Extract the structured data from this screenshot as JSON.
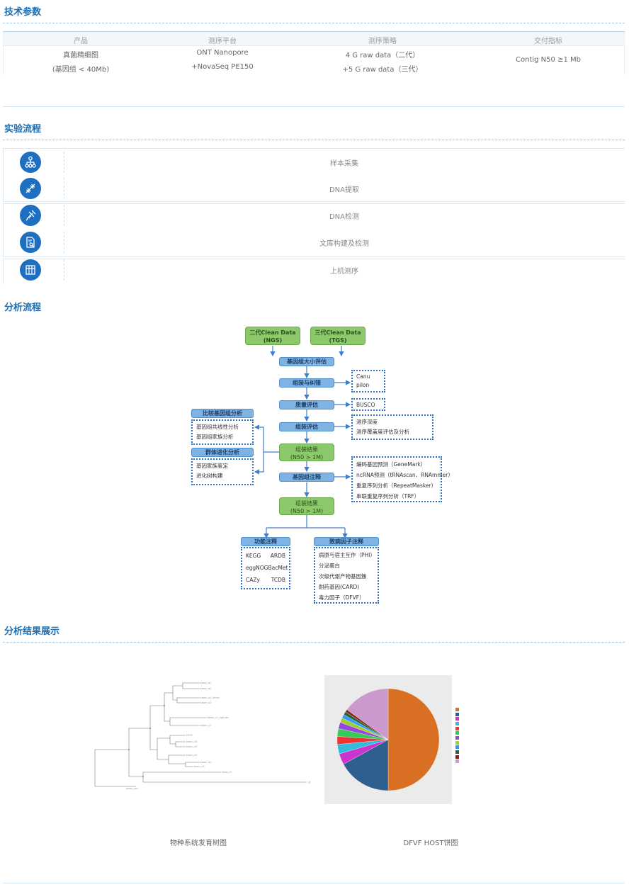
{
  "sections": {
    "tech": "技术参数",
    "experiment": "实验流程",
    "analysis": "分析流程",
    "results": "分析结果展示"
  },
  "spec_table": {
    "headers": [
      "产品",
      "测序平台",
      "测序策略",
      "交付指标"
    ],
    "product_line1": "真菌精细图",
    "product_line2": "(基因组 < 40Mb)",
    "platform_line1": "ONT Nanopore",
    "platform_line2": "+NovaSeq PE150",
    "strategy_line1": "4 G raw data（二代）",
    "strategy_line2": "+5 G raw data（三代）",
    "delivery": "Contig N50 ≥1 Mb"
  },
  "experiment_steps": [
    {
      "label": "样本采集",
      "icon": "sample-network-icon"
    },
    {
      "label": "DNA提取",
      "icon": "dna-icon"
    },
    {
      "label": "DNA检测",
      "icon": "dna-test-icon"
    },
    {
      "label": "文库构建及检测",
      "icon": "document-search-icon"
    },
    {
      "label": "上机测序",
      "icon": "grid-sequencer-icon"
    }
  ],
  "analysis_flow": {
    "ngs": "二代Clean Data\n(NGS)",
    "tgs": "三代Clean Data\n(TGS)",
    "step1": "基因组大小评估",
    "step2": "组装与纠错",
    "step2_notes": [
      "Canu",
      "pilon"
    ],
    "step3": "质量评估",
    "step3_notes": [
      "BUSCO"
    ],
    "step4": "组装评估",
    "step4_notes": [
      "测序深度",
      "测序覆盖度评估及分析"
    ],
    "result1": "组装结果\n(N50 > 1M)",
    "step5": "基因组注释",
    "step5_notes": [
      "编码基因预测（GeneMark）",
      "ncRNA预测（tRNAscan、RNAmmer）",
      "重复序列分析（RepeatMasker）",
      "串联重复序列分析（TRF）"
    ],
    "result2": "组装结果\n(N50 > 1M)",
    "left_top_title": "比较基因组分析",
    "left_top": [
      "基因组共线性分析",
      "基因组家族分析"
    ],
    "left_mid_title": "群体进化分析",
    "left_mid": [
      "基因家族鉴定",
      "进化树构建"
    ],
    "bottom_left_title": "功能注释",
    "bottom_left": [
      [
        "KEGG",
        "ARDB"
      ],
      [
        "eggNOG",
        "BacMet"
      ],
      [
        "CAZy",
        "TCDB"
      ]
    ],
    "bottom_right_title": "致病因子注释",
    "bottom_right": [
      "病原与宿主互作（PHI）",
      "分泌蛋白",
      "次级代谢产物基因簇",
      "耐药基因(CARD)",
      "毒力因子（DFVF）"
    ]
  },
  "results": {
    "caption_left": "物种系统发育树图",
    "caption_right": "DFVF HOST饼图"
  },
  "chart_data": {
    "type": "pie",
    "title": "",
    "slices": [
      {
        "label": "",
        "value": 50,
        "color": "#d86f23"
      },
      {
        "label": "",
        "value": 17,
        "color": "#2f5f8f"
      },
      {
        "label": "",
        "value": 3.5,
        "color": "#cc33cc"
      },
      {
        "label": "",
        "value": 3,
        "color": "#33bbdd"
      },
      {
        "label": "",
        "value": 2.5,
        "color": "#ee3333"
      },
      {
        "label": "",
        "value": 2.5,
        "color": "#33cc55"
      },
      {
        "label": "",
        "value": 2,
        "color": "#9944dd"
      },
      {
        "label": "",
        "value": 1.5,
        "color": "#a0d030"
      },
      {
        "label": "",
        "value": 1.2,
        "color": "#3399ff"
      },
      {
        "label": "",
        "value": 1,
        "color": "#226633"
      },
      {
        "label": "",
        "value": 0.8,
        "color": "#882222"
      },
      {
        "label": "",
        "value": 15,
        "color": "#cc99cc"
      }
    ],
    "legend_placement": "right"
  },
  "colors": {
    "accent": "#1a6fb5",
    "green_box": "#8cc96b",
    "blue_bar": "#7fb3e3"
  }
}
